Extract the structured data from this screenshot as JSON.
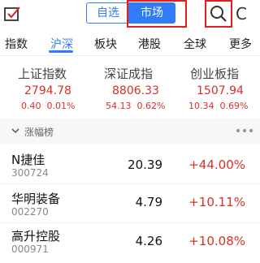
{
  "header": {
    "segments": [
      "自选",
      "市场"
    ],
    "refresh_glyph": "C",
    "icons": {
      "logo": "checkbox-icon",
      "search": "search-icon",
      "refresh": "refresh-icon"
    }
  },
  "tabs": [
    "指数",
    "沪深",
    "板块",
    "港股",
    "全球",
    "更多"
  ],
  "active_tab": 1,
  "indices": [
    {
      "name": "上证指数",
      "value": "2794.78",
      "change": "0.40",
      "pct": "0.01%"
    },
    {
      "name": "深证成指",
      "value": "8806.33",
      "change": "54.13",
      "pct": "0.62%"
    },
    {
      "name": "创业板指",
      "value": "1507.94",
      "change": "10.34",
      "pct": "0.69%"
    }
  ],
  "section": {
    "title": "涨幅榜"
  },
  "rows": [
    {
      "name": "N捷佳",
      "code": "300724",
      "price": "20.39",
      "pct": "+44.00%"
    },
    {
      "name": "华明装备",
      "code": "002270",
      "price": "4.79",
      "pct": "+10.11%"
    },
    {
      "name": "高升控股",
      "code": "000971",
      "price": "4.26",
      "pct": "+10.08%"
    }
  ],
  "colors": {
    "accent": "#2f7cf6",
    "up": "#d93025",
    "highlight": "#e02020"
  }
}
